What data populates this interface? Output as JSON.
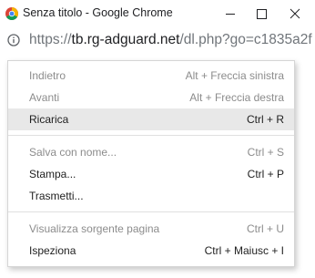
{
  "window": {
    "title": "Senza titolo - Google Chrome",
    "controls": [
      "minimize",
      "maximize",
      "close"
    ]
  },
  "address_bar": {
    "scheme": "https://",
    "host": "tb.rg-adguard.net",
    "path": "/dl.php?go=c1835a2f",
    "icon": "info-icon"
  },
  "context_menu": {
    "items": [
      {
        "label": "Indietro",
        "shortcut": "Alt + Freccia sinistra",
        "enabled": false
      },
      {
        "label": "Avanti",
        "shortcut": "Alt + Freccia destra",
        "enabled": false
      },
      {
        "label": "Ricarica",
        "shortcut": "Ctrl + R",
        "enabled": true,
        "highlighted": true
      },
      {
        "label": "Salva con nome...",
        "shortcut": "Ctrl + S",
        "enabled": false
      },
      {
        "label": "Stampa...",
        "shortcut": "Ctrl + P",
        "enabled": true
      },
      {
        "label": "Trasmetti...",
        "shortcut": "",
        "enabled": true
      },
      {
        "label": "Visualizza sorgente pagina",
        "shortcut": "Ctrl + U",
        "enabled": false
      },
      {
        "label": "Ispeziona",
        "shortcut": "Ctrl + Maiusc + I",
        "enabled": true
      }
    ]
  },
  "colors": {
    "menu_highlight": "#e8e8e8",
    "disabled_text": "#8c8c8c"
  }
}
